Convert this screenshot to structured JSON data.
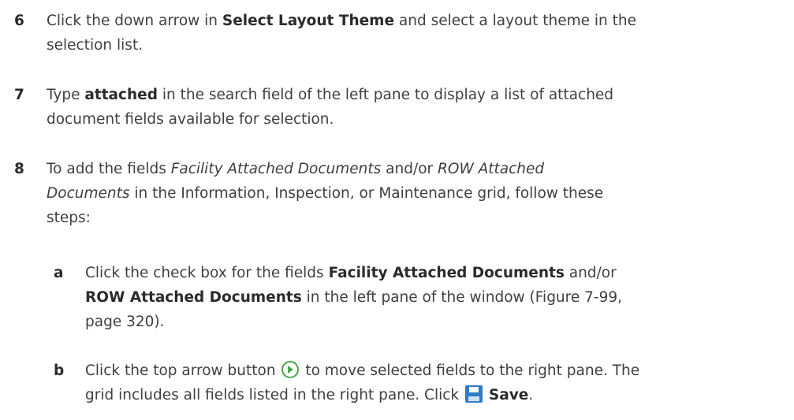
{
  "steps": [
    {
      "number": "6",
      "lines": [
        {
          "t1": "Click the down arrow in ",
          "b1": "Select Layout Theme",
          "t2": " and select a layout theme in the"
        },
        {
          "t1": "selection list."
        }
      ]
    },
    {
      "number": "7",
      "lines": [
        {
          "t1": "Type ",
          "b1": "attached",
          "t2": " in the search field of the left pane to display a list of attached"
        },
        {
          "t1": "document fields available for selection."
        }
      ]
    },
    {
      "number": "8",
      "lines": [
        {
          "t1": "To add the fields ",
          "i1": "Facility Attached Documents",
          "t2": " and/or ",
          "i2": "ROW Attached"
        },
        {
          "i1": "Documents",
          "t1": " in the Information, Inspection, or Maintenance grid, follow these"
        },
        {
          "t1": "steps:"
        }
      ]
    }
  ],
  "substeps": [
    {
      "letter": "a",
      "lines": [
        {
          "t1": "Click the check box for the fields ",
          "b1": "Facility Attached Documents",
          "t2": " and/or"
        },
        {
          "b1": "ROW Attached Documents",
          "t1": " in the left pane of the window (Figure 7-99,"
        },
        {
          "t1": "page 320)."
        }
      ]
    },
    {
      "letter": "b",
      "lines": [
        {
          "t1": "Click the top arrow button ",
          "t2": " to move selected fields to the right pane. The"
        },
        {
          "t1": "grid includes all fields listed in the right pane. Click ",
          "b1": "Save",
          "t2": "."
        }
      ]
    }
  ],
  "icons": {
    "arrow": "right-arrow-circle-icon",
    "save": "floppy-save-icon"
  },
  "colors": {
    "text": "#3f3f3f",
    "bold": "#2b2b2b",
    "arrow_icon": "#45a84a",
    "save_icon": "#2f7bc6"
  }
}
